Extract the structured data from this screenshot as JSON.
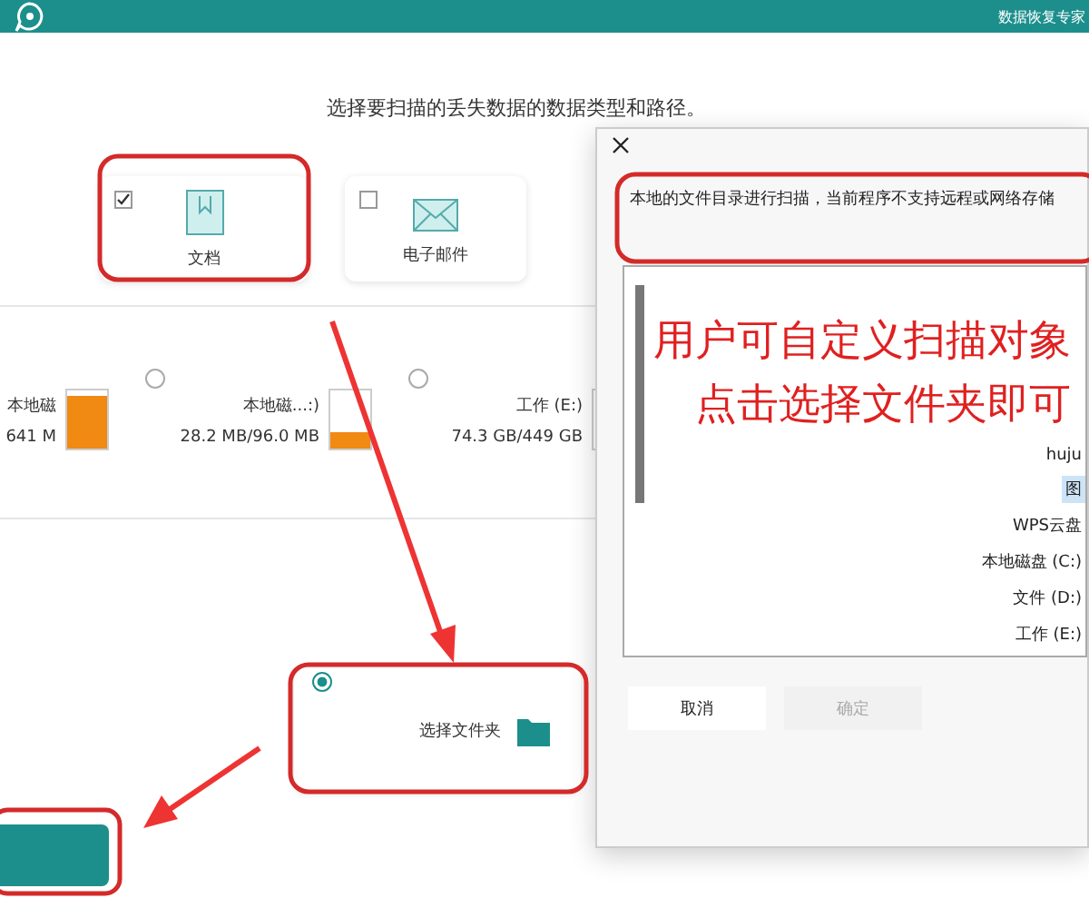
{
  "header": {
    "title": "数据恢复专家"
  },
  "instruction": "选择要扫描的丢失数据的数据类型和路径。",
  "categories": [
    {
      "kind": "document",
      "label": "文档",
      "checked": true
    },
    {
      "kind": "email",
      "label": "电子邮件",
      "checked": false
    }
  ],
  "drives": [
    {
      "name": "本地磁",
      "usage": "641 M",
      "level": 0.92
    },
    {
      "name": "本地磁...:)",
      "usage": "28.2 MB/96.0 MB",
      "level": 0.28,
      "selected": false
    },
    {
      "name": "工作 (E:)",
      "usage": "74.3 GB/449 GB",
      "selected": false
    }
  ],
  "folder_option": {
    "label": "选择文件夹",
    "selected": true
  },
  "dialog": {
    "message": "本地的文件目录进行扫描，当前程序不支持远程或网络存储",
    "tree": [
      {
        "label": "huju",
        "selected": false
      },
      {
        "label": "图",
        "selected": true
      },
      {
        "label": "WPS云盘",
        "selected": false
      },
      {
        "label": "本地磁盘 (C:)",
        "selected": false
      },
      {
        "label": "文件 (D:)",
        "selected": false
      },
      {
        "label": "工作 (E:)",
        "selected": false
      }
    ],
    "buttons": [
      {
        "label": "取消",
        "disabled": false
      },
      {
        "label": "确定",
        "disabled": true
      }
    ]
  },
  "annotation": {
    "lines": [
      "用户可自定义扫描对象",
      "点击选择文件夹即可"
    ]
  }
}
